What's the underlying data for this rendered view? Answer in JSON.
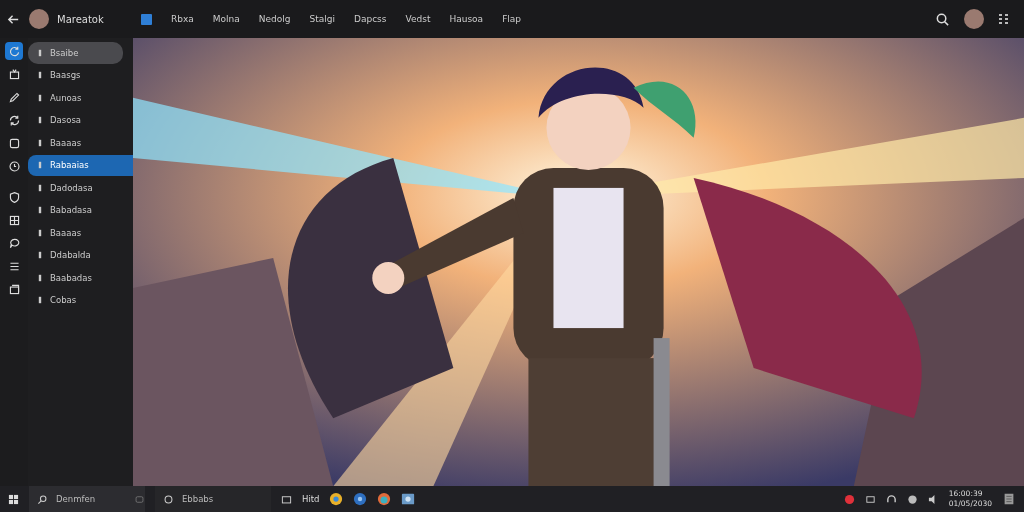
{
  "profile": {
    "name": "Mareatok"
  },
  "nav": [
    {
      "label": "Rbxa"
    },
    {
      "label": "Molna"
    },
    {
      "label": "Nedolg"
    },
    {
      "label": "Stalgi"
    },
    {
      "label": "Dapcss"
    },
    {
      "label": "Vedst"
    },
    {
      "label": "Hausoa"
    },
    {
      "label": "Flap"
    }
  ],
  "rail": [
    {
      "kind": "refresh",
      "selected": true
    },
    {
      "kind": "tv",
      "selected": false
    },
    {
      "kind": "pen",
      "selected": false
    },
    {
      "kind": "sync",
      "selected": false
    },
    {
      "kind": "square",
      "selected": false
    },
    {
      "kind": "clock",
      "selected": false
    },
    {
      "kind": "shield",
      "selected": false
    },
    {
      "kind": "grid",
      "selected": false
    },
    {
      "kind": "chat",
      "selected": false
    },
    {
      "kind": "menu",
      "selected": false
    },
    {
      "kind": "stack",
      "selected": false
    }
  ],
  "sidebar": {
    "items": [
      {
        "label": "Bsaibe",
        "highlighted": true,
        "selected": false
      },
      {
        "label": "Baasgs",
        "highlighted": false,
        "selected": false
      },
      {
        "label": "Aunoas",
        "highlighted": false,
        "selected": false
      },
      {
        "label": "Dasosa",
        "highlighted": false,
        "selected": false
      },
      {
        "label": "Baaaas",
        "highlighted": false,
        "selected": false
      },
      {
        "label": "Rabaaias",
        "highlighted": false,
        "selected": true
      },
      {
        "label": "Dadodasa",
        "highlighted": false,
        "selected": false
      },
      {
        "label": "Babadasa",
        "highlighted": false,
        "selected": false
      },
      {
        "label": "Baaaas",
        "highlighted": false,
        "selected": false
      },
      {
        "label": "Ddabalda",
        "highlighted": false,
        "selected": false
      },
      {
        "label": "Baabadas",
        "highlighted": false,
        "selected": false
      },
      {
        "label": "Cobas",
        "highlighted": false,
        "selected": false
      }
    ]
  },
  "taskbar": {
    "search": {
      "placeholder": "Denmfen"
    },
    "field": {
      "placeholder": "Ebbabs"
    },
    "app_label": "Hitd",
    "clock": {
      "time": "16:00:39",
      "date": "01/05/2030"
    }
  }
}
